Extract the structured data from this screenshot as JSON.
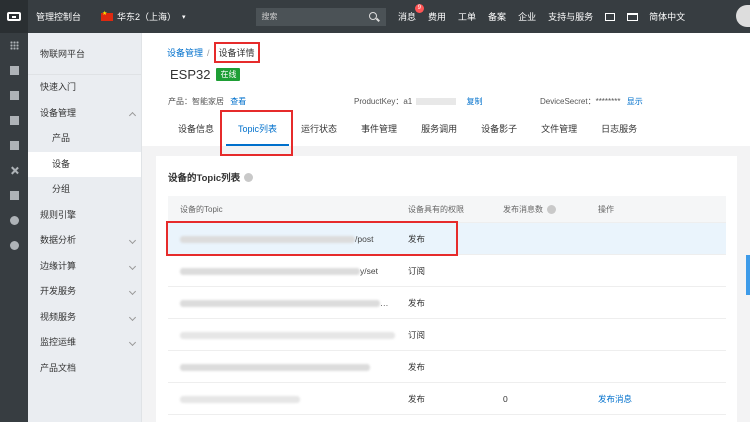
{
  "topbar": {
    "console_title": "管理控制台",
    "region": "华东2（上海）",
    "search_placeholder": "搜索",
    "nav": {
      "messages": "消息",
      "messages_badge": "9",
      "billing": "费用",
      "ticket": "工单",
      "filing": "备案",
      "enterprise": "企业",
      "support": "支持与服务",
      "language": "简体中文"
    }
  },
  "sidebar": {
    "title": "物联网平台",
    "items": [
      {
        "label": "快速入门"
      },
      {
        "label": "设备管理"
      },
      {
        "label": "产品"
      },
      {
        "label": "设备"
      },
      {
        "label": "分组"
      },
      {
        "label": "规则引擎"
      },
      {
        "label": "数据分析"
      },
      {
        "label": "边缘计算"
      },
      {
        "label": "开发服务"
      },
      {
        "label": "视频服务"
      },
      {
        "label": "监控运维"
      },
      {
        "label": "产品文档"
      }
    ]
  },
  "breadcrumb": {
    "parent": "设备管理",
    "current": "设备详情"
  },
  "device": {
    "name": "ESP32",
    "status": "在线",
    "product_label": "产品：",
    "product_value": "智能家居",
    "product_link": "查看",
    "productkey_label": "ProductKey：",
    "productkey_prefix": "a1",
    "productkey_copy": "复制",
    "secret_label": "DeviceSecret：",
    "secret_value": "********",
    "secret_show": "显示"
  },
  "tabs": [
    {
      "label": "设备信息"
    },
    {
      "label": "Topic列表"
    },
    {
      "label": "运行状态"
    },
    {
      "label": "事件管理"
    },
    {
      "label": "服务调用"
    },
    {
      "label": "设备影子"
    },
    {
      "label": "文件管理"
    },
    {
      "label": "日志服务"
    }
  ],
  "topic_panel": {
    "title": "设备的Topic列表",
    "columns": {
      "topic": "设备的Topic",
      "permission": "设备具有的权限",
      "count": "发布消息数",
      "action": "操作"
    },
    "rows": [
      {
        "topic_tail": "/post",
        "permission": "发布",
        "count": "",
        "action": ""
      },
      {
        "topic_tail": "y/set",
        "permission": "订阅",
        "count": "",
        "action": ""
      },
      {
        "topic_tail": "…",
        "permission": "发布",
        "count": "",
        "action": ""
      },
      {
        "topic_tail": "",
        "permission": "订阅",
        "count": "",
        "action": ""
      },
      {
        "topic_tail": "",
        "permission": "发布",
        "count": "",
        "action": ""
      },
      {
        "topic_tail": "",
        "permission": "发布",
        "count": "0",
        "action": "发布消息"
      }
    ]
  }
}
